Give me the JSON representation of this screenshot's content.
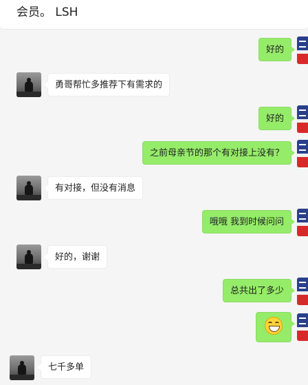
{
  "header": {
    "text": "会员。 LSH"
  },
  "messages": [
    {
      "side": "out",
      "text": "好的"
    },
    {
      "side": "in",
      "text": "勇哥帮忙多推荐下有需求的"
    },
    {
      "side": "out",
      "text": "好的"
    },
    {
      "side": "out",
      "text": "之前母亲节的那个有对接上没有？"
    },
    {
      "side": "in",
      "text": "有对接，但没有消息"
    },
    {
      "side": "out",
      "text": "哦哦 我到时候问问"
    },
    {
      "side": "in",
      "text": "好的，谢谢"
    },
    {
      "side": "out",
      "text": "总共出了多少"
    },
    {
      "side": "out",
      "emoji": "grinning-face"
    },
    {
      "side": "in",
      "text": "七千多单"
    }
  ],
  "colors": {
    "outgoing_bubble": "#95ec69",
    "incoming_bubble": "#ffffff",
    "background": "#f5f5f5"
  }
}
